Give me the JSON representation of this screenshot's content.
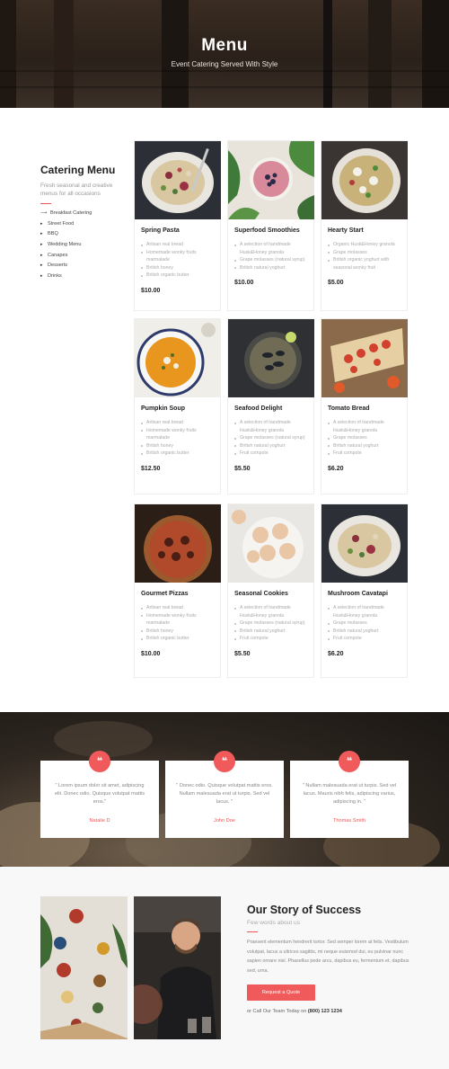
{
  "hero": {
    "title": "Menu",
    "subtitle": "Event Catering Served With Style"
  },
  "sidebar": {
    "title": "Catering Menu",
    "description": "Fresh seasonal and creative menus for all occasions",
    "items": [
      {
        "label": "Breakfast Catering",
        "active": true
      },
      {
        "label": "Street Food",
        "active": false
      },
      {
        "label": "BBQ",
        "active": false
      },
      {
        "label": "Wedding Menu",
        "active": false
      },
      {
        "label": "Canapes",
        "active": false
      },
      {
        "label": "Desserts",
        "active": false
      },
      {
        "label": "Drinks",
        "active": false
      }
    ]
  },
  "cards": [
    {
      "name": "Spring Pasta",
      "items": [
        "Artisan real bread",
        "Homemade wonky fruits marmalade",
        "British honey",
        "British organic butter"
      ],
      "price": "$10.00"
    },
    {
      "name": "Superfood Smoothies",
      "items": [
        "A selection of handmade Husk&Honey granola",
        "Grape molasses (natural syrup)",
        "British natural yoghurt"
      ],
      "price": "$10.00"
    },
    {
      "name": "Hearty Start",
      "items": [
        "Organic Husk&Honey granola",
        "Grape molasses",
        "British organic yoghurt with seasonal wonky fruit"
      ],
      "price": "$5.00"
    },
    {
      "name": "Pumpkin Soup",
      "items": [
        "Artisan real bread",
        "Homemade wonky fruits marmalade",
        "British honey",
        "British organic butter"
      ],
      "price": "$12.50"
    },
    {
      "name": "Seafood Delight",
      "items": [
        "A selection of handmade Husk&Honey granola",
        "Grape molasses (natural syrup)",
        "British natural yoghurt",
        "Fruit compote"
      ],
      "price": "$5.50"
    },
    {
      "name": "Tomato Bread",
      "items": [
        "A selection of handmade Husk&Honey granola",
        "Grape molasses",
        "British natural yoghurt",
        "Fruit compote"
      ],
      "price": "$6.20"
    },
    {
      "name": "Gourmet Pizzas",
      "items": [
        "Artisan real bread",
        "Homemade wonky fruits marmalade",
        "British honey",
        "British organic butter"
      ],
      "price": "$10.00"
    },
    {
      "name": "Seasonal Cookies",
      "items": [
        "A selection of handmade Husk&Honey granola",
        "Grape molasses (natural syrup)",
        "British natural yoghurt",
        "Fruit compote"
      ],
      "price": "$5.50"
    },
    {
      "name": "Mushroom Cavatapi",
      "items": [
        "A selection of handmade Husk&Honey granola",
        "Grape molasses",
        "British natural yoghurt",
        "Fruit compote"
      ],
      "price": "$6.20"
    }
  ],
  "testimonials": [
    {
      "text": "\" Lorem ipsum dolor sit amet, adipiscing elit. Donec odio. Quisque volutpat mattis eros.\"",
      "name": "Natalie D"
    },
    {
      "text": "\" Donec odio. Quisque volutpat mattis eros. Nullam malesuada erat ut turpis. Sed vel lacus. \"",
      "name": "John Doe"
    },
    {
      "text": "\" Nullam malesuada erat ut turpis. Sed vel lacus. Mauris nibh felis, adipiscing varius, adipiscing in. \"",
      "name": "Thomas Smith"
    }
  ],
  "quote_icon": "quote-icon",
  "story": {
    "title": "Our Story of Success",
    "subtitle": "Few words about us",
    "text": "Praesent elementum hendrerit tortor. Sed semper lorem at felis. Vestibulum volutpat, lacus a ultrices sagittis, mi neque euismod dui, eu pulvinar nunc sapien ornare nisl. Phasellus pede arcu, dapibus eu, fermentum et, dapibus sed, urna.",
    "button_label": "Request a Quote",
    "call_prefix": "or Call Our Team Today on",
    "phone": "(800) 123 1234"
  },
  "colors": {
    "accent": "#f05a5a",
    "text_dark": "#222222",
    "text_muted": "#aaaaaa"
  }
}
